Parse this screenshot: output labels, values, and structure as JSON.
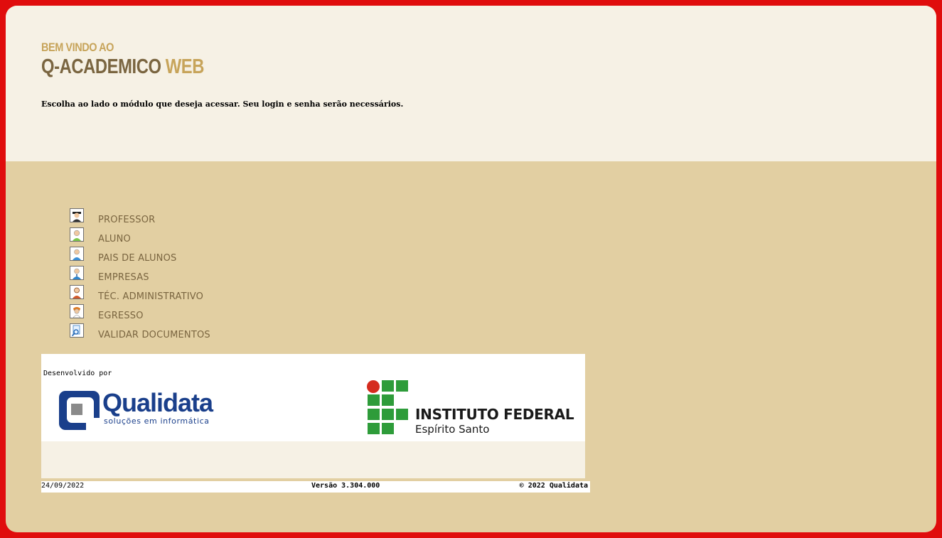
{
  "header": {
    "welcome": "BEM VINDO AO",
    "app_name": "Q-ACADEMICO",
    "app_name_accent": "WEB",
    "intro": "Escolha ao lado o módulo que deseja acessar. Seu login e senha serão necessários."
  },
  "modules": [
    {
      "label": "PROFESSOR",
      "icon": "professor-icon"
    },
    {
      "label": "ALUNO",
      "icon": "student-icon"
    },
    {
      "label": "PAIS DE ALUNOS",
      "icon": "parents-icon"
    },
    {
      "label": "EMPRESAS",
      "icon": "companies-icon"
    },
    {
      "label": "TÉC. ADMINISTRATIVO",
      "icon": "admin-staff-icon"
    },
    {
      "label": "EGRESSO",
      "icon": "graduate-icon"
    },
    {
      "label": "VALIDAR DOCUMENTOS",
      "icon": "validate-documents-icon"
    }
  ],
  "banner": {
    "developed_by": "Desenvolvido por",
    "company_name": "Qualidata",
    "company_slogan": "soluções em informática",
    "institution_name": "INSTITUTO FEDERAL",
    "institution_campus": "Espírito Santo"
  },
  "footer": {
    "date": "24/09/2022",
    "version": "Versão 3.304.000",
    "copyright": "© 2022 Qualidata"
  },
  "colors": {
    "frame": "#e00d0d",
    "top_background": "#f6f1e5",
    "main_background": "#e2cfa2",
    "gold": "#c7a45a",
    "brown": "#7a6540",
    "qualidata_blue": "#1a3f8b",
    "if_green": "#2e9c3a",
    "if_red": "#d52b1e"
  }
}
